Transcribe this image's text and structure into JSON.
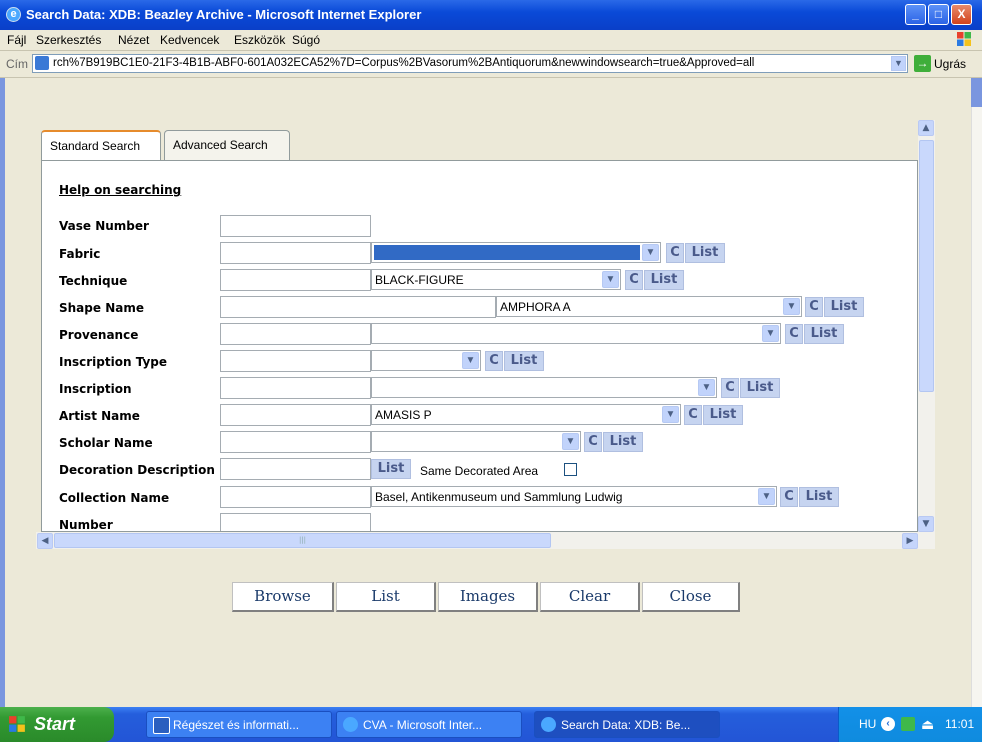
{
  "window": {
    "title": "Search Data: XDB: Beazley Archive - Microsoft Internet Explorer",
    "minimize": "_",
    "maximize": "□",
    "close": "X"
  },
  "menu": [
    "Fájl",
    "Szerkesztés",
    "Nézet",
    "Kedvencek",
    "Eszközök",
    "Súgó"
  ],
  "address": {
    "label": "Cím",
    "url": "rch%7B919BC1E0-21F3-4B1B-ABF0-601A032ECA52%7D=Corpus%2BVasorum%2BAntiquorum&newwindowsearch=true&Approved=all",
    "go_label": "Ugrás"
  },
  "tabs": {
    "standard": "Standard Search",
    "advanced": "Advanced Search"
  },
  "form": {
    "help": "Help on searching",
    "fields": {
      "vase_number": "Vase Number",
      "fabric": "Fabric",
      "technique": "Technique",
      "shape_name": "Shape Name",
      "provenance": "Provenance",
      "inscription_type": "Inscription Type",
      "inscription": "Inscription",
      "artist_name": "Artist Name",
      "scholar_name": "Scholar Name",
      "decoration_description": "Decoration Description",
      "collection_name": "Collection Name",
      "number": "Number"
    },
    "values": {
      "technique": "BLACK-FIGURE",
      "shape_name": "AMPHORA A",
      "artist_name": "AMASIS P",
      "collection_name": "Basel, Antikenmuseum und Sammlung Ludwig"
    },
    "c_label": "C",
    "list_label": "List",
    "same_decorated_area": "Same Decorated Area"
  },
  "actions": {
    "browse": "Browse",
    "list": "List",
    "images": "Images",
    "clear": "Clear",
    "close": "Close"
  },
  "taskbar": {
    "start": "Start",
    "tasks": [
      "Régészet és informati...",
      "CVA - Microsoft Inter...",
      "Search Data: XDB: Be..."
    ],
    "lang": "HU",
    "clock": "11:01"
  }
}
